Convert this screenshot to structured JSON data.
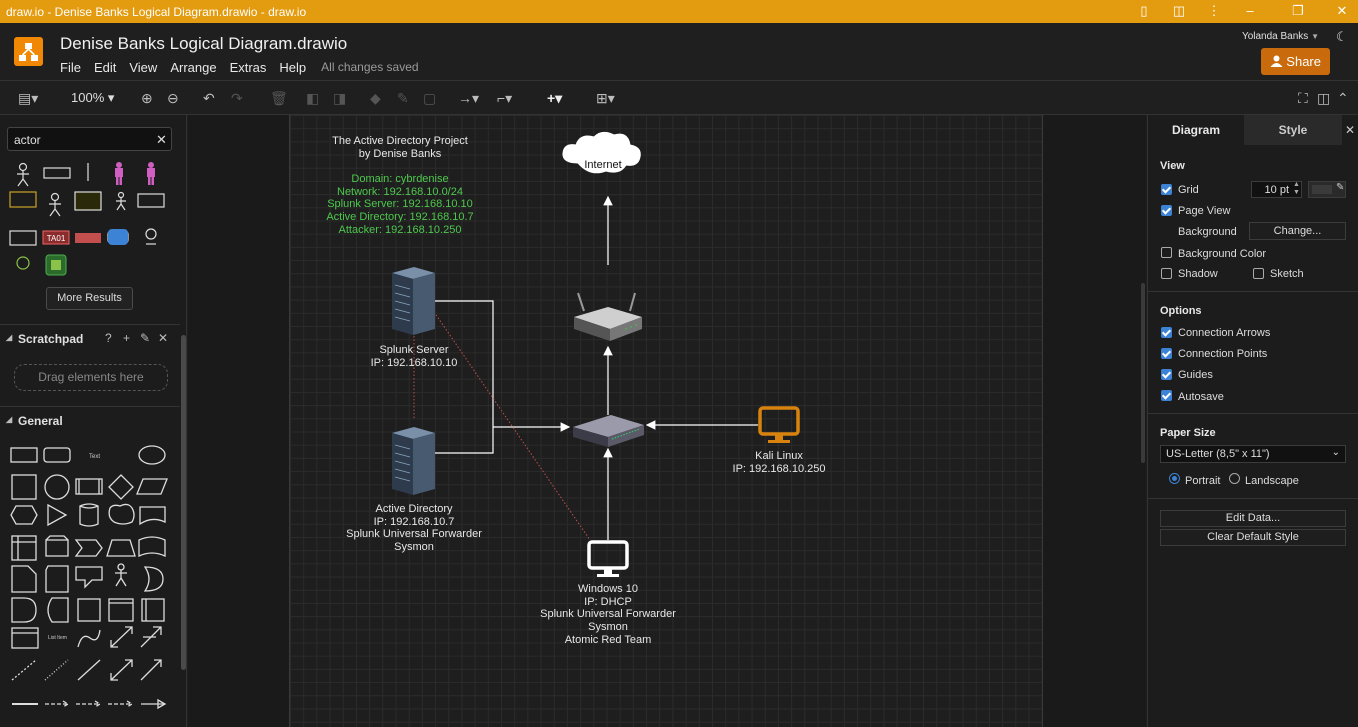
{
  "window": {
    "title": "draw.io - Denise Banks Logical Diagram.drawio - draw.io"
  },
  "header": {
    "doc_title": "Denise Banks Logical Diagram.drawio",
    "menu": [
      "File",
      "Edit",
      "View",
      "Arrange",
      "Extras",
      "Help"
    ],
    "save_status": "All changes saved",
    "user": "Yolanda Banks",
    "share_label": "Share"
  },
  "toolbar": {
    "zoom": "100%"
  },
  "left_panel": {
    "search_value": "actor",
    "more_results": "More Results",
    "scratchpad_title": "Scratchpad",
    "drag_hint": "Drag elements here",
    "general_title": "General",
    "shape_label_ta01": "TA01"
  },
  "diagram": {
    "title_line1": "The Active Directory Project",
    "title_line2": "by Denise Banks",
    "info": [
      "Domain: cybrdenise",
      "Network: 192.168.10.0/24",
      "Splunk Server: 192.168.10.10",
      "Active Directory: 192.168.10.7",
      "Attacker: 192.168.10.250"
    ],
    "internet": "Internet",
    "splunk": [
      "Splunk Server",
      "IP: 192.168.10.10"
    ],
    "ad": [
      "Active Directory",
      "IP: 192.168.10.7",
      "Splunk Universal Forwarder",
      "Sysmon"
    ],
    "kali": [
      "Kali Linux",
      "IP: 192.168.10.250"
    ],
    "win": [
      "Windows 10",
      "IP: DHCP",
      "Splunk Universal Forwarder",
      "Sysmon",
      "Atomic Red Team"
    ]
  },
  "right_panel": {
    "tab_diagram": "Diagram",
    "tab_style": "Style",
    "view_h": "View",
    "grid": "Grid",
    "grid_size": "10 pt",
    "page_view": "Page View",
    "background": "Background",
    "change": "Change...",
    "bg_color": "Background Color",
    "shadow": "Shadow",
    "sketch": "Sketch",
    "options_h": "Options",
    "conn_arrows": "Connection Arrows",
    "conn_points": "Connection Points",
    "guides": "Guides",
    "autosave": "Autosave",
    "paper_h": "Paper Size",
    "paper_value": "US-Letter (8,5\" x 11\")",
    "portrait": "Portrait",
    "landscape": "Landscape",
    "edit_data": "Edit Data...",
    "clear_style": "Clear Default Style"
  },
  "colors": {
    "titlebar": "#e39b10",
    "share": "#c96b0c",
    "info_green": "#4ec84e",
    "check_blue": "#3c83d6",
    "kali_orange": "#d9830f"
  }
}
